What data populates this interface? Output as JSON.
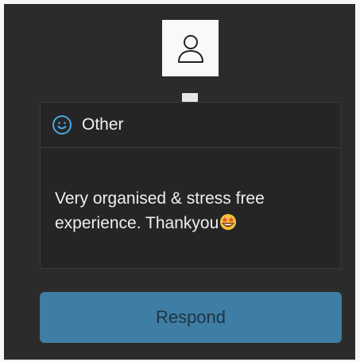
{
  "avatar": {
    "icon": "user-icon"
  },
  "review": {
    "category_icon": "smile-icon",
    "category": "Other",
    "comment": "Very organised & stress free experience. Thankyou",
    "emoji": "star-struck-emoji"
  },
  "actions": {
    "respond_label": "Respond"
  },
  "colors": {
    "background": "#2b2b2b",
    "card": "#252525",
    "accent_icon": "#4aa8e0",
    "button": "#3e7ea4",
    "button_text": "#1e3444"
  }
}
